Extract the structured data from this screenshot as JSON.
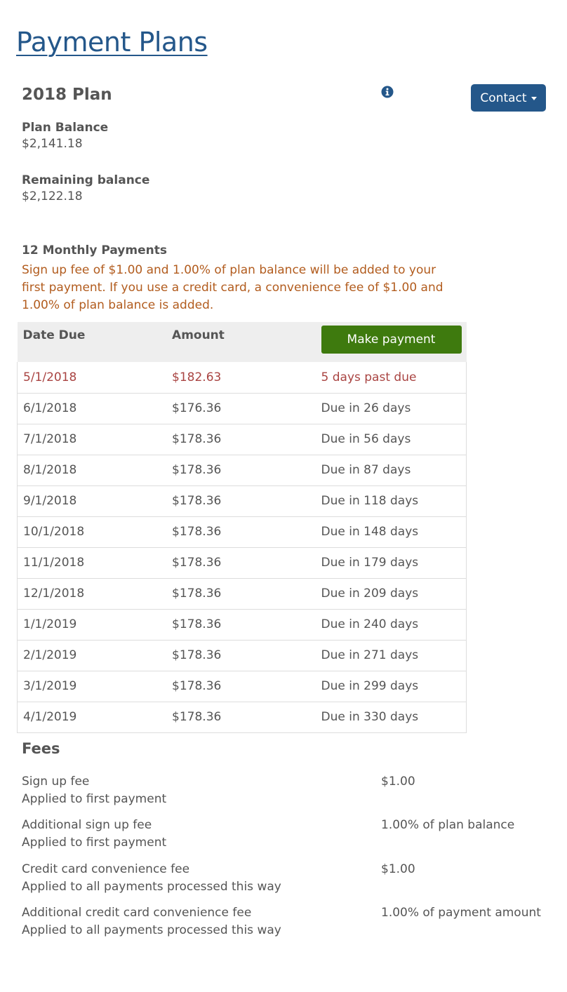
{
  "page": {
    "title": "Payment Plans"
  },
  "plan": {
    "name": "2018 Plan",
    "contact_label": "Contact",
    "balance_label": "Plan Balance",
    "balance_value": "$2,141.18",
    "remaining_label": "Remaining balance",
    "remaining_value": "$2,122.18",
    "payments_label": "12 Monthly Payments",
    "notice": "Sign up fee of $1.00 and 1.00% of plan balance will be added to your first payment. If you use a credit card, a convenience fee of $1.00 and 1.00% of plan balance is added."
  },
  "icons": {
    "info": "info-icon",
    "contact_caret": "caret-down-icon"
  },
  "colors": {
    "brand": "#24578a",
    "pay_button": "#3e7a0e",
    "overdue": "#a94442",
    "notice": "#b25c1e"
  },
  "schedule": {
    "headers": {
      "date": "Date Due",
      "amount": "Amount",
      "action": "Make payment"
    },
    "rows": [
      {
        "date": "5/1/2018",
        "amount": "$182.63",
        "status": "5 days past due"
      },
      {
        "date": "6/1/2018",
        "amount": "$176.36",
        "status": "Due in 26 days"
      },
      {
        "date": "7/1/2018",
        "amount": "$178.36",
        "status": "Due in 56 days"
      },
      {
        "date": "8/1/2018",
        "amount": "$178.36",
        "status": "Due in 87 days"
      },
      {
        "date": "9/1/2018",
        "amount": "$178.36",
        "status": "Due in 118 days"
      },
      {
        "date": "10/1/2018",
        "amount": "$178.36",
        "status": "Due in 148 days"
      },
      {
        "date": "11/1/2018",
        "amount": "$178.36",
        "status": "Due in 179 days"
      },
      {
        "date": "12/1/2018",
        "amount": "$178.36",
        "status": "Due in 209 days"
      },
      {
        "date": "1/1/2019",
        "amount": "$178.36",
        "status": "Due in 240 days"
      },
      {
        "date": "2/1/2019",
        "amount": "$178.36",
        "status": "Due in 271 days"
      },
      {
        "date": "3/1/2019",
        "amount": "$178.36",
        "status": "Due in 299 days"
      },
      {
        "date": "4/1/2019",
        "amount": "$178.36",
        "status": "Due in 330 days"
      }
    ]
  },
  "fees": {
    "title": "Fees",
    "items": [
      {
        "name": "Sign up fee",
        "note": "Applied to first payment",
        "amount": "$1.00"
      },
      {
        "name": "Additional sign up fee",
        "note": "Applied to first payment",
        "amount": "1.00% of plan balance"
      },
      {
        "name": "Credit card convenience fee",
        "note": "Applied to all payments processed this way",
        "amount": "$1.00"
      },
      {
        "name": "Additional credit card convenience fee",
        "note": "Applied to all payments processed this way",
        "amount": "1.00% of payment amount"
      }
    ]
  }
}
